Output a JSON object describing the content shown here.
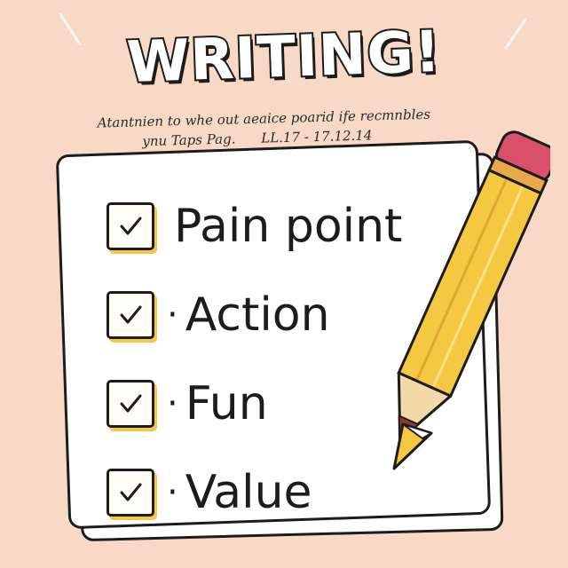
{
  "title": "WRITING!",
  "subtitle": {
    "line1": "Atantnien to whe out aeaice poarid ife recmnbles",
    "line2": "ynu Taps Pag.",
    "date": "LL.17 - 17.12.14"
  },
  "checklist": {
    "items": [
      {
        "label": "Pain point",
        "bullet": "",
        "checked": true
      },
      {
        "label": "Action",
        "bullet": "·",
        "checked": true
      },
      {
        "label": "Fun",
        "bullet": "·",
        "checked": true
      },
      {
        "label": "Value",
        "bullet": "·",
        "checked": true
      }
    ]
  },
  "icons": {
    "checkbox": "checked-checkbox-icon",
    "pencil": "pencil-icon"
  },
  "colors": {
    "background": "#f8d9c6",
    "paper": "#ffffff",
    "ink": "#1c1c1c",
    "pencil_body": "#f5c842",
    "pencil_eraser": "#d9506a",
    "pencil_ferrule": "#e8a94a",
    "checkbox_shadow": "#f2c94c"
  }
}
